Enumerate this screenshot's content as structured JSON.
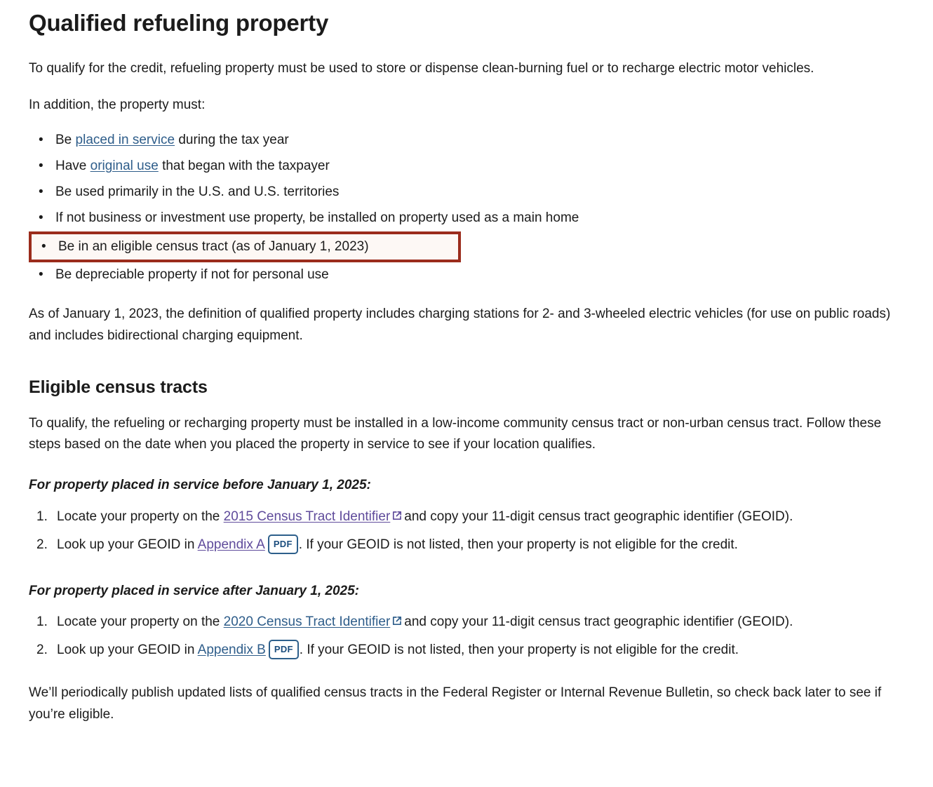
{
  "page": {
    "title": "Qualified refueling property",
    "intro": "To qualify for the credit, refueling property must be used to store or dispense clean-burning fuel or to recharge electric motor vehicles.",
    "intro2": "In addition, the property must:",
    "requirements": [
      {
        "prefix": "Be ",
        "link": "placed in service",
        "link_style": "blue",
        "suffix": " during the tax year",
        "highlighted": false
      },
      {
        "prefix": "Have ",
        "link": "original use",
        "link_style": "blue",
        "suffix": " that began with the taxpayer",
        "highlighted": false
      },
      {
        "prefix": "Be used primarily in the U.S. and U.S. territories",
        "link": "",
        "link_style": "",
        "suffix": "",
        "highlighted": false
      },
      {
        "prefix": "If not business or investment use property, be installed on property used as a main home",
        "link": "",
        "link_style": "",
        "suffix": "",
        "highlighted": false
      },
      {
        "prefix": "Be in an eligible census tract (as of January 1, 2023)",
        "link": "",
        "link_style": "",
        "suffix": "",
        "highlighted": true
      },
      {
        "prefix": "Be depreciable property if not for personal use",
        "link": "",
        "link_style": "",
        "suffix": "",
        "highlighted": false
      }
    ],
    "after_list_paragraph": "As of January 1, 2023, the definition of qualified property includes charging stations for 2- and 3-wheeled electric vehicles (for use on public roads) and includes bidirectional charging equipment.",
    "section_title": "Eligible census tracts",
    "section_intro": "To qualify, the refueling or recharging property must be installed in a low-income community census tract or non-urban census tract. Follow these steps based on the date when you placed the property in service to see if your location qualifies.",
    "before_2025": {
      "heading": "For property placed in service before January 1, 2025:",
      "step1_before_link": "Locate your property on the ",
      "step1_link": "2015 Census Tract Identifier",
      "step1_link_style": "visited",
      "step1_after_link": "and copy your 11-digit census tract geographic identifier (GEOID).",
      "step2_before_link": "Look up your GEOID in ",
      "step2_link": "Appendix A",
      "step2_link_style": "visited",
      "step2_badge": "PDF",
      "step2_after_link": ". If your GEOID is not listed, then your property is not eligible for the credit."
    },
    "after_2025": {
      "heading": "For property placed in service after January 1, 2025:",
      "step1_before_link": "Locate your property on the ",
      "step1_link": "2020 Census Tract Identifier",
      "step1_link_style": "blue",
      "step1_after_link": "and copy your 11-digit census tract geographic identifier (GEOID).",
      "step2_before_link": "Look up your GEOID in ",
      "step2_link": "Appendix B",
      "step2_link_style": "blue",
      "step2_badge": "PDF",
      "step2_after_link": ". If your GEOID is not listed, then your property is not eligible for the credit."
    },
    "closing_paragraph": "We’ll periodically publish updated lists of qualified census tracts in the Federal Register or Internal Revenue Bulletin, so check back later to see if you’re eligible.",
    "icons": {
      "external_link": "external-link-icon"
    },
    "colors": {
      "highlight_border": "#9b2c1c",
      "highlight_fill": "#fdf8f5",
      "link_blue": "#2e5d8a",
      "link_visited": "#5f4b9b",
      "pdf_badge_border": "#2d5f8b",
      "text": "#1b1b1b"
    }
  }
}
